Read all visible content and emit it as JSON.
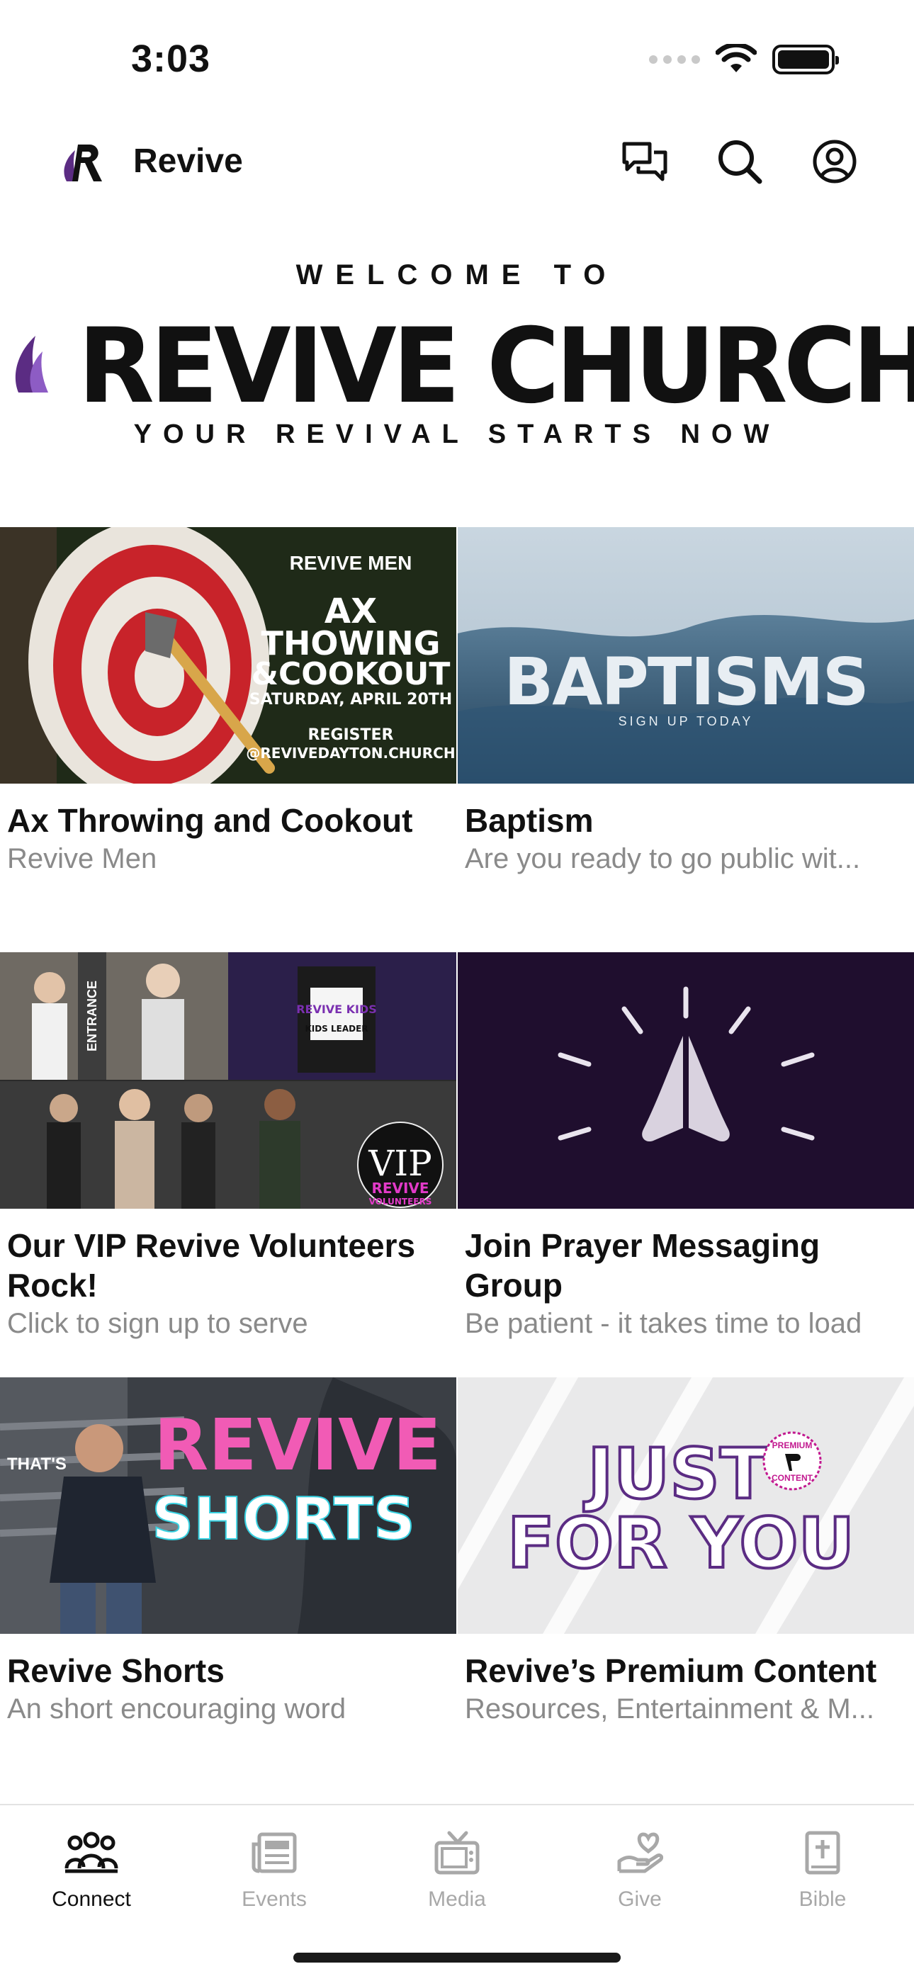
{
  "status_bar": {
    "time": "3:03"
  },
  "header": {
    "app_name": "Revive",
    "icons": [
      "chat-icon",
      "search-icon",
      "profile-icon"
    ]
  },
  "banner": {
    "welcome": "WELCOME TO",
    "church_name": "REVIVE CHURCH",
    "tagline": "YOUR REVIVAL STARTS NOW"
  },
  "cards": [
    {
      "title": "Ax Throwing and Cookout",
      "subtitle": "Revive Men",
      "image_text": [
        "REVIVE MEN",
        "AX",
        "THOWING",
        "&COOKOUT",
        "SATURDAY, APRIL 20TH",
        "REGISTER",
        "@REVIVEDAYTON.CHURCH"
      ]
    },
    {
      "title": "Baptism",
      "subtitle": "Are you ready to go public wit...",
      "image_text": [
        "BAPTISMS",
        "SIGN UP TODAY"
      ]
    },
    {
      "title": "Our VIP Revive Volunteers Rock!",
      "subtitle": "Click to sign up to serve",
      "image_text": [
        "ENTRANCE",
        "REVIVE KIDS",
        "KIDS LEADER",
        "VIP",
        "REVIVE",
        "VOLUNTEERS"
      ]
    },
    {
      "title": "Join Prayer Messaging Group",
      "subtitle": "Be patient - it takes time to load",
      "image_text": []
    },
    {
      "title": "Revive Shorts",
      "subtitle": "An short encouraging word",
      "image_text": [
        "THAT'S",
        "REVIVE",
        "SHORTS"
      ]
    },
    {
      "title": "Revive’s Premium Content",
      "subtitle": "Resources, Entertainment & M...",
      "image_text": [
        "JUST",
        "FOR YOU",
        "PREMIUM",
        "CONTENT"
      ]
    }
  ],
  "tab_bar": {
    "tabs": [
      {
        "label": "Connect",
        "icon": "people-icon",
        "active": true
      },
      {
        "label": "Events",
        "icon": "newspaper-icon",
        "active": false
      },
      {
        "label": "Media",
        "icon": "tv-icon",
        "active": false
      },
      {
        "label": "Give",
        "icon": "hand-heart-icon",
        "active": false
      },
      {
        "label": "Bible",
        "icon": "bible-icon",
        "active": false
      }
    ]
  },
  "colors": {
    "accent_purple": "#5b2c83",
    "text_secondary": "#8a8a8a",
    "prayer_bg": "#1f0e2e",
    "shorts_pink": "#f15bb5"
  }
}
